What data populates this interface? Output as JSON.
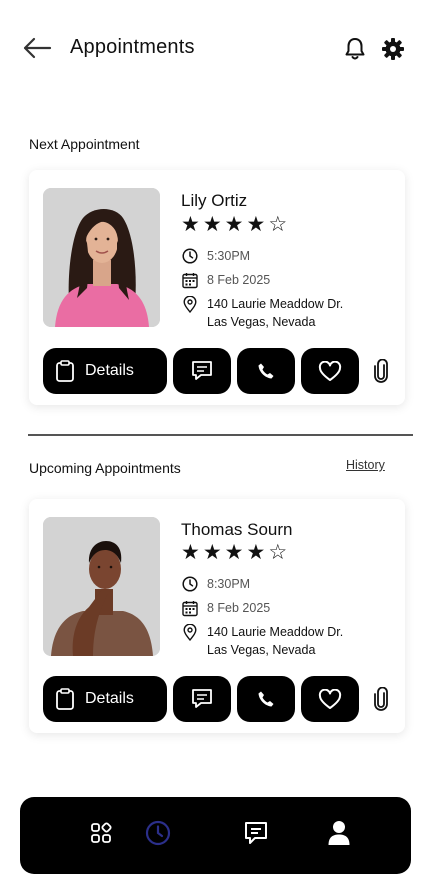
{
  "header": {
    "title": "Appointments",
    "back_icon": "arrow-left-icon",
    "notification_icon": "bell-icon",
    "settings_icon": "gear-icon"
  },
  "next_section": {
    "title": "Next Appointment",
    "card": {
      "name": "Lily Ortiz",
      "rating": 4,
      "rating_max": 5,
      "time": "5:30PM",
      "date": "8 Feb 2025",
      "address_line1": "140 Laurie Meaddow Dr.",
      "address_line2": "Las Vegas, Nevada",
      "details_label": "Details"
    }
  },
  "upcoming_section": {
    "title": "Upcoming Appointments",
    "history_label": "History",
    "card": {
      "name": "Thomas Sourn",
      "rating": 4,
      "rating_max": 5,
      "time": "8:30PM",
      "date": "8 Feb 2025",
      "address_line1": "140 Laurie Meaddow Dr.",
      "address_line2": "Las Vegas, Nevada",
      "details_label": "Details"
    }
  },
  "bottom_nav": {
    "items": [
      {
        "icon": "grid-icon",
        "active": false
      },
      {
        "icon": "clock-icon",
        "active": true
      },
      {
        "icon": "chat-icon",
        "active": false
      },
      {
        "icon": "user-icon",
        "active": false
      }
    ],
    "active_color": "#2b2f8a"
  },
  "colors": {
    "button_bg": "#000000",
    "text_primary": "#111111",
    "text_secondary": "#555555"
  }
}
